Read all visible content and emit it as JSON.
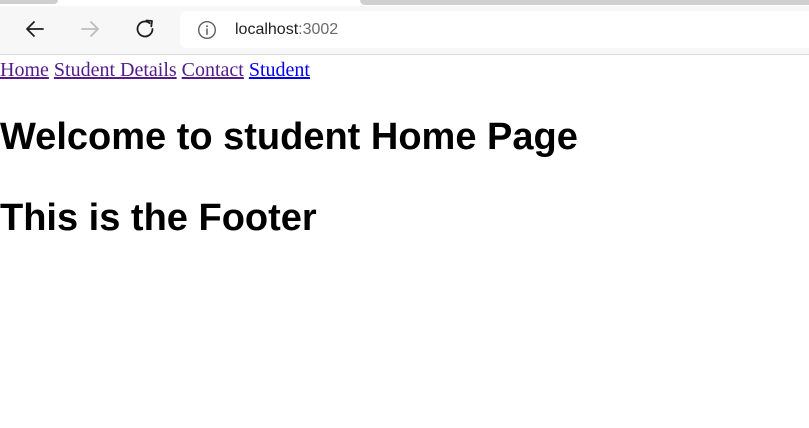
{
  "browser": {
    "url_host": "localhost",
    "url_port": ":3002",
    "icons": {
      "back": "arrow-left-icon",
      "forward": "arrow-right-icon",
      "reload": "reload-icon",
      "site_info": "info-icon"
    }
  },
  "navbar": {
    "links": [
      {
        "label": "Home",
        "visited": true
      },
      {
        "label": "Student Details",
        "visited": true
      },
      {
        "label": "Contact",
        "visited": true
      },
      {
        "label": "Student",
        "visited": false
      }
    ]
  },
  "main": {
    "welcome_heading": "Welcome to student Home Page"
  },
  "footer": {
    "heading": "This is the Footer"
  },
  "colors": {
    "visited_link": "#551a8b",
    "unvisited_link": "#0000ee",
    "toolbar_bg": "#f7f7f7"
  }
}
